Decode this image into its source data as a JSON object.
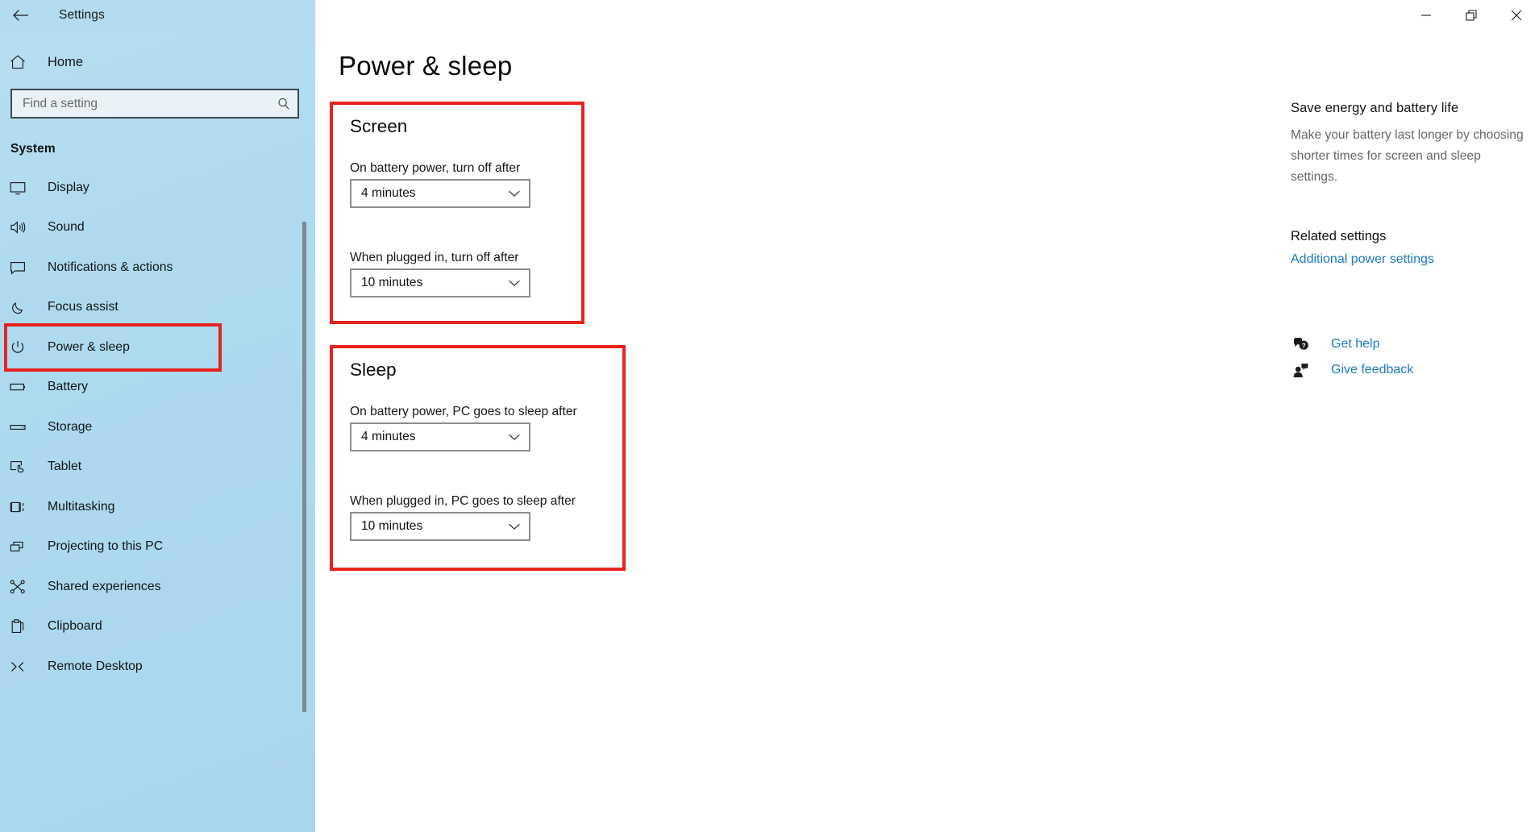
{
  "window": {
    "title": "Settings",
    "back_icon": "back-arrow-icon",
    "controls": [
      {
        "name": "minimize-button",
        "icon": "minimize-icon"
      },
      {
        "name": "restore-button",
        "icon": "restore-icon"
      },
      {
        "name": "close-button",
        "icon": "close-icon"
      }
    ]
  },
  "sidebar": {
    "home": {
      "label": "Home",
      "icon": "home-icon"
    },
    "search": {
      "placeholder": "Find a setting",
      "value": "",
      "icon": "search-icon"
    },
    "section_title": "System",
    "selected_item": "Power & sleep",
    "items": [
      {
        "label": "Display",
        "icon": "monitor-icon"
      },
      {
        "label": "Sound",
        "icon": "speaker-icon"
      },
      {
        "label": "Notifications & actions",
        "icon": "chat-bubble-icon"
      },
      {
        "label": "Focus assist",
        "icon": "moon-icon"
      },
      {
        "label": "Power & sleep",
        "icon": "power-icon"
      },
      {
        "label": "Battery",
        "icon": "battery-icon"
      },
      {
        "label": "Storage",
        "icon": "drive-icon"
      },
      {
        "label": "Tablet",
        "icon": "tablet-icon"
      },
      {
        "label": "Multitasking",
        "icon": "multitasking-icon"
      },
      {
        "label": "Projecting to this PC",
        "icon": "projecting-icon"
      },
      {
        "label": "Shared experiences",
        "icon": "share-nodes-icon"
      },
      {
        "label": "Clipboard",
        "icon": "clipboard-icon"
      },
      {
        "label": "Remote Desktop",
        "icon": "remote-desktop-icon"
      }
    ]
  },
  "main": {
    "page_title": "Power & sleep",
    "sections": [
      {
        "heading": "Screen",
        "fields": [
          {
            "label": "On battery power, turn off after",
            "value": "4 minutes"
          },
          {
            "label": "When plugged in, turn off after",
            "value": "10 minutes"
          }
        ]
      },
      {
        "heading": "Sleep",
        "fields": [
          {
            "label": "On battery power, PC goes to sleep after",
            "value": "4 minutes"
          },
          {
            "label": "When plugged in, PC goes to sleep after",
            "value": "10 minutes"
          }
        ]
      }
    ]
  },
  "right_rail": {
    "heading": "Save energy and battery life",
    "body": "Make your battery last longer by choosing shorter times for screen and sleep settings.",
    "related_heading": "Related settings",
    "related_link": "Additional power settings",
    "help_links": [
      {
        "label": "Get help",
        "icon": "get-help-icon"
      },
      {
        "label": "Give feedback",
        "icon": "give-feedback-icon"
      }
    ]
  },
  "colors": {
    "sidebar_blue": "#addaef",
    "annotation_red": "#e8221f",
    "link_blue": "#1a78c2",
    "muted_text": "#63666a"
  }
}
